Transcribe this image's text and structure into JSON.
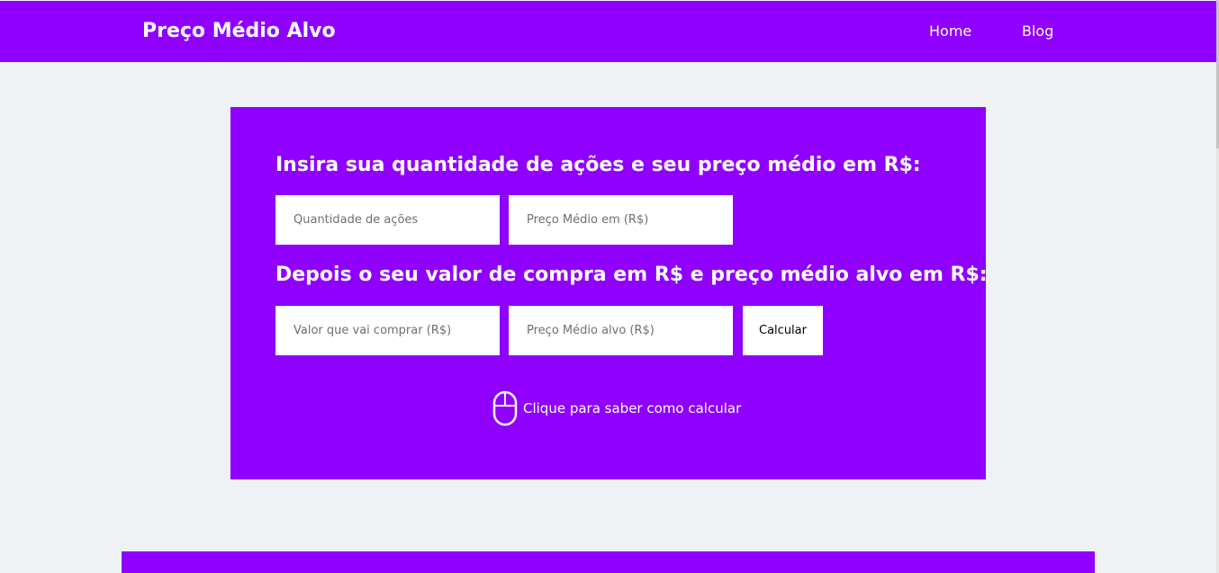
{
  "navbar": {
    "brand": "Preço Médio Alvo",
    "links": [
      "Home",
      "Blog"
    ]
  },
  "card": {
    "heading_1": "Insira sua quantidade de ações e seu preço médio em R$:",
    "heading_2": "Depois o seu valor de compra em R$ e preço médio alvo em R$:",
    "fields": {
      "quantity_placeholder": "Quantidade de ações",
      "avg_price_placeholder": "Preço Médio em (R$)",
      "purchase_value_placeholder": "Valor que vai comprar (R$)",
      "target_avg_placeholder": "Preço Médio alvo (R$)"
    },
    "calculate_label": "Calcular",
    "help_text": "Clique para saber como calcular",
    "help_icon": "mouse-icon"
  },
  "colors": {
    "accent": "#8f00ff",
    "background": "#f0f1f4",
    "surface": "#ffffff"
  }
}
